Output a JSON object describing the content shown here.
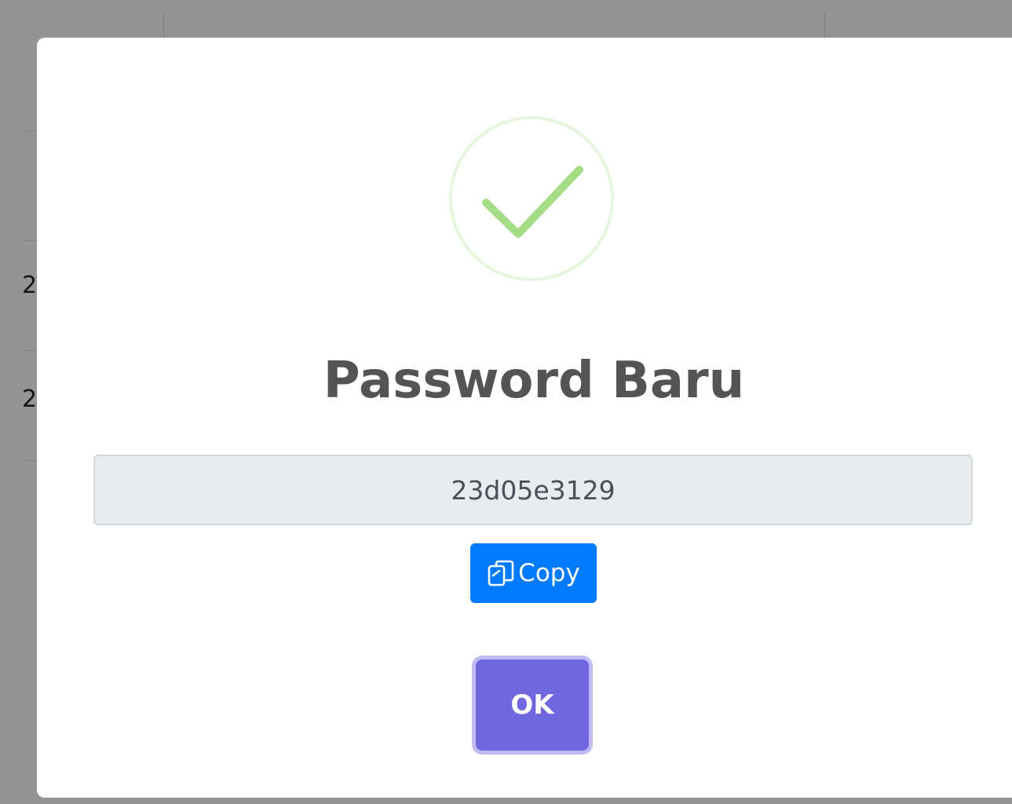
{
  "background": {
    "row_cells": [
      "2",
      "2"
    ]
  },
  "dialog": {
    "icon": "success-check-icon",
    "title": "Password Baru",
    "password_value": "23d05e3129",
    "copy_label": "Copy",
    "copy_icon": "copy-icon",
    "confirm_label": "OK"
  },
  "colors": {
    "success": "#a5dc86",
    "success_ring": "#e6f5dd",
    "copy_button": "#007bff",
    "confirm_button": "#7066e0",
    "title_text": "#545454"
  }
}
